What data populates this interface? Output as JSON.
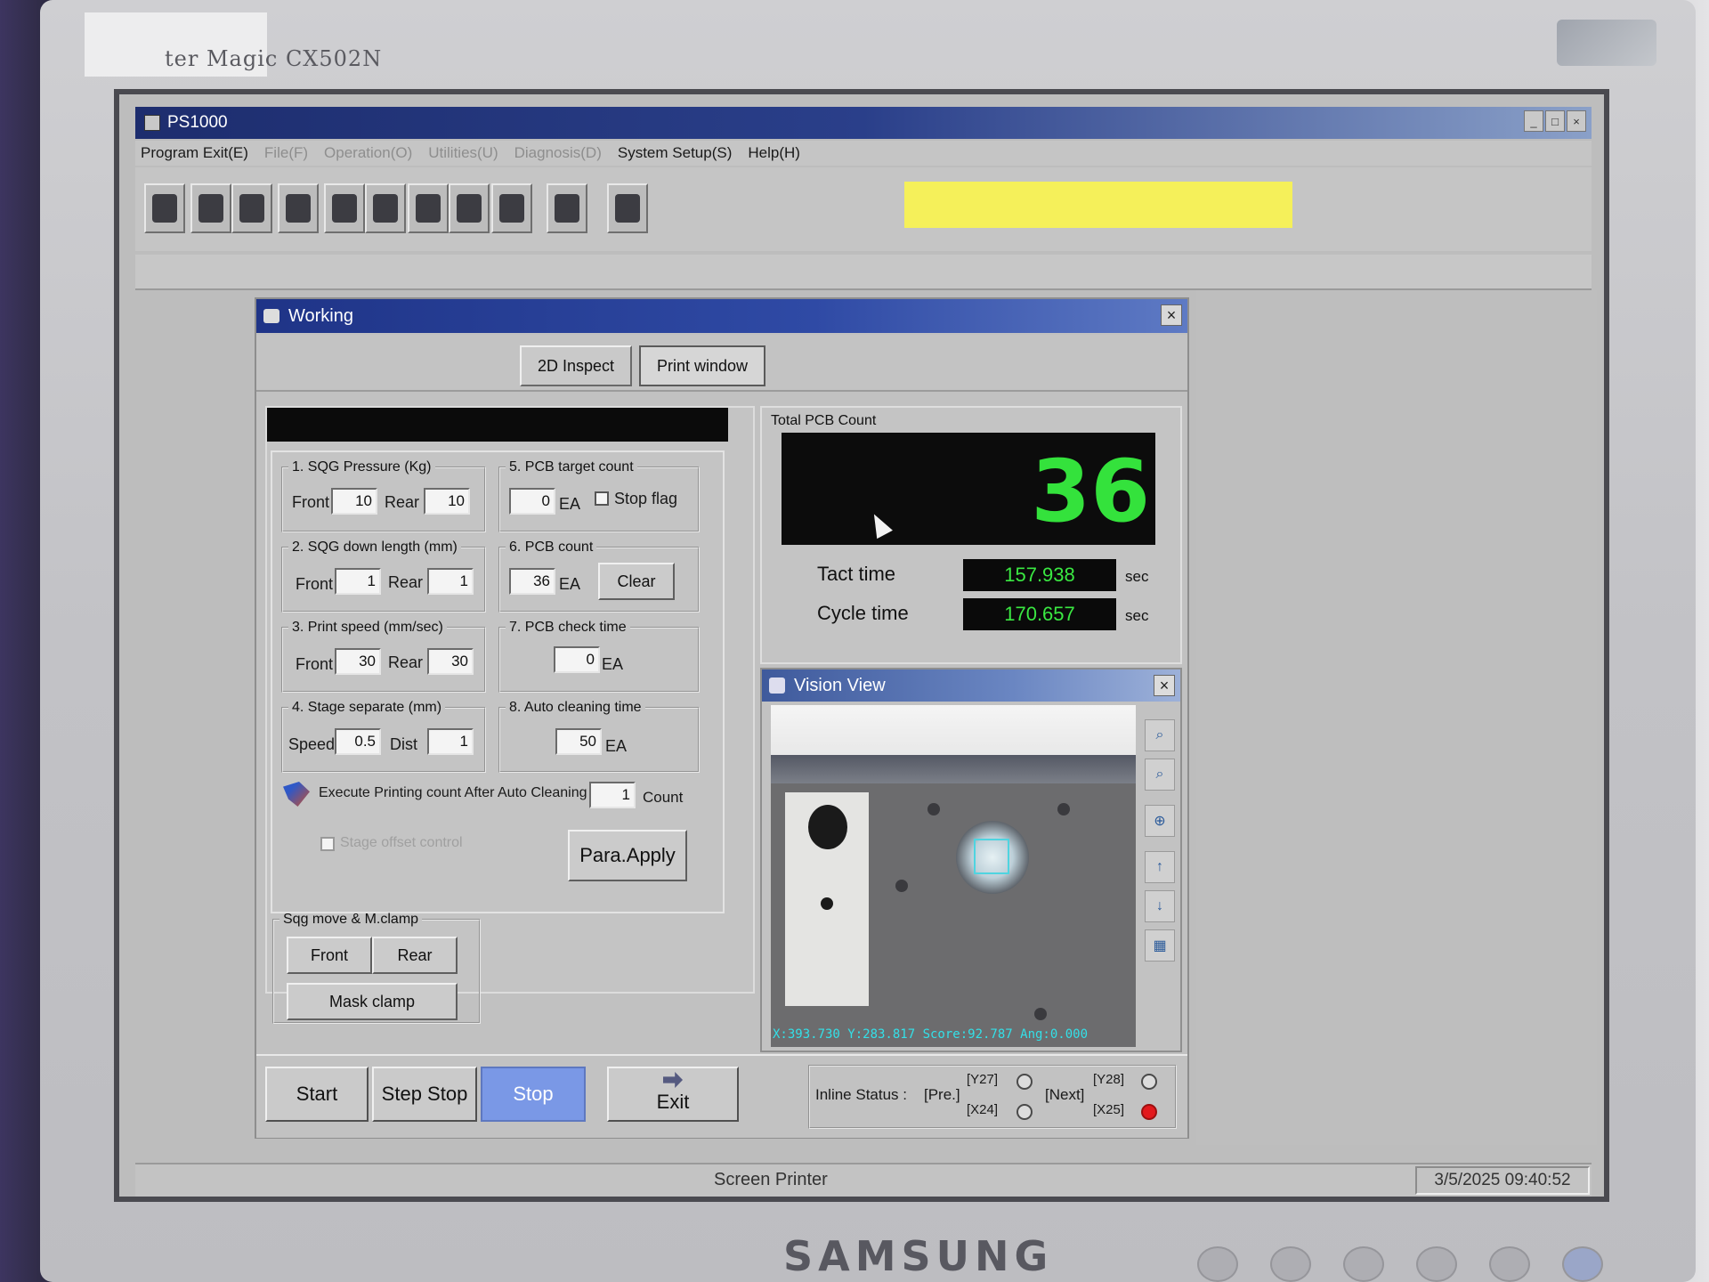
{
  "monitor": {
    "model": "ter Magic CX502N",
    "brand": "SAMSUNG"
  },
  "app": {
    "title": "PS1000",
    "menu": [
      "Program Exit(E)",
      "File(F)",
      "Operation(O)",
      "Utilities(U)",
      "Diagnosis(D)",
      "System Setup(S)",
      "Help(H)"
    ],
    "menu_enabled": [
      true,
      false,
      false,
      false,
      false,
      true,
      true
    ],
    "highlight_color": "#f5f05a"
  },
  "working": {
    "title": "Working",
    "tabs": [
      "2D Inspect",
      "Print window"
    ],
    "active_tab": "Print window"
  },
  "params": {
    "sqg_pressure": {
      "legend": "1. SQG Pressure (Kg)",
      "front_label": "Front",
      "front": "10",
      "rear_label": "Rear",
      "rear": "10"
    },
    "sqg_down": {
      "legend": "2. SQG down length (mm)",
      "front_label": "Front",
      "front": "1",
      "rear_label": "Rear",
      "rear": "1"
    },
    "print_speed": {
      "legend": "3. Print speed (mm/sec)",
      "front_label": "Front",
      "front": "30",
      "rear_label": "Rear",
      "rear": "30"
    },
    "stage_separate": {
      "legend": "4. Stage separate (mm)",
      "speed_label": "Speed",
      "speed": "0.5",
      "dist_label": "Dist",
      "dist": "1"
    },
    "pcb_target": {
      "legend": "5. PCB target count",
      "value": "0",
      "unit": "EA",
      "stop_flag_label": "Stop flag"
    },
    "pcb_count": {
      "legend": "6. PCB count",
      "value": "36",
      "unit": "EA",
      "clear_label": "Clear"
    },
    "pcb_check": {
      "legend": "7. PCB check time",
      "value": "0",
      "unit": "EA"
    },
    "auto_cleaning": {
      "legend": "8. Auto cleaning time",
      "value": "50",
      "unit": "EA"
    },
    "execute_label": "Execute Printing count After Auto Cleaning",
    "execute_value": "1",
    "execute_unit": "Count",
    "stage_offset_label": "Stage offset control",
    "apply_label": "Para.Apply"
  },
  "sqg_move": {
    "legend": "Sqg move & M.clamp",
    "front": "Front",
    "rear": "Rear",
    "mask_clamp": "Mask clamp"
  },
  "counter": {
    "label": "Total PCB Count",
    "total": "36",
    "tact_label": "Tact time",
    "tact_value": "157.938",
    "cycle_label": "Cycle time",
    "cycle_value": "170.657",
    "unit": "sec"
  },
  "vision": {
    "title": "Vision View",
    "readout": "X:393.730 Y:283.817 Score:92.787 Ang:0.000",
    "tools": [
      "zoom-x2-icon",
      "zoom-x1-icon",
      "center-target-icon",
      "align-up-icon",
      "align-down-icon",
      "color-palette-icon"
    ]
  },
  "controls": {
    "start": "Start",
    "step_stop": "Step Stop",
    "stop": "Stop",
    "exit": "Exit"
  },
  "inline": {
    "label": "Inline Status :",
    "pre": "[Pre.]",
    "next": "[Next]",
    "y27": "[Y27]",
    "x24": "[X24]",
    "y28": "[Y28]",
    "x25": "[X25]"
  },
  "status": {
    "center": "Screen Printer",
    "datetime": "3/5/2025  09:40:52"
  }
}
